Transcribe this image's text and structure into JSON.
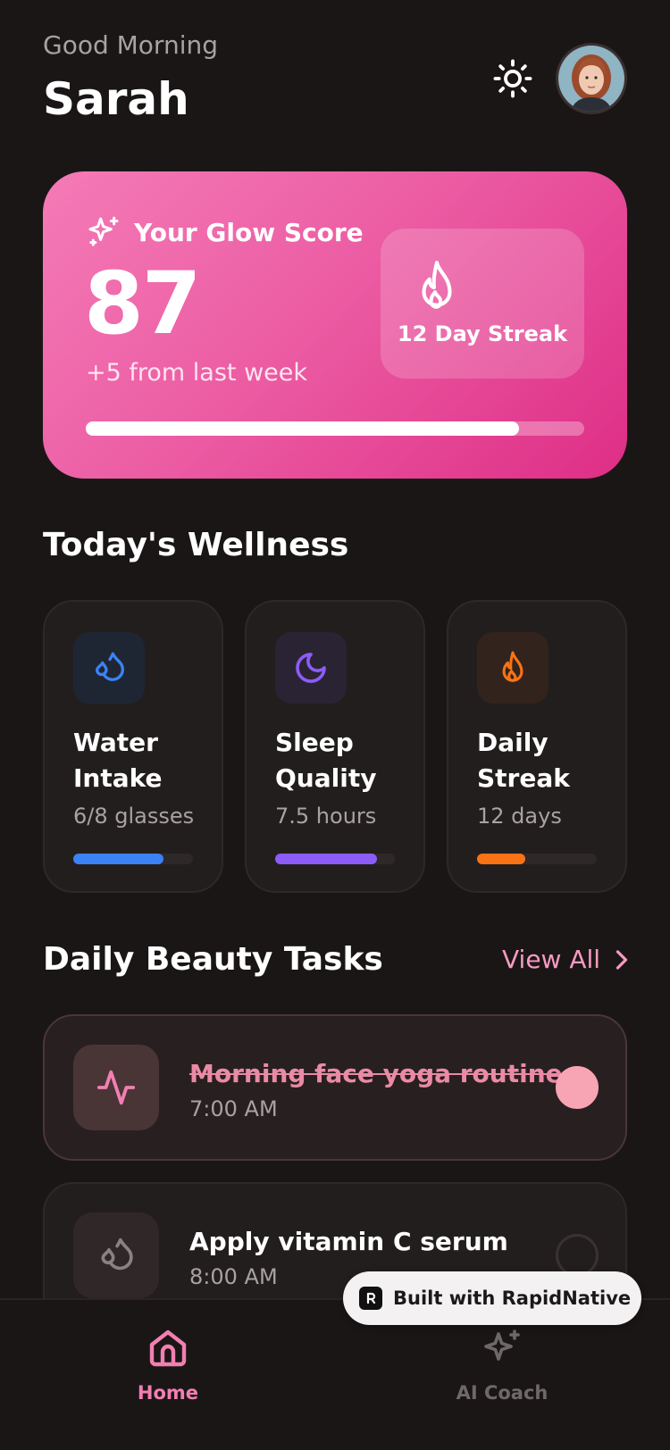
{
  "header": {
    "greeting": "Good Morning",
    "name": "Sarah"
  },
  "glow_card": {
    "title": "Your Glow Score",
    "score": "87",
    "change": "+5 from last week",
    "streak_label": "12 Day Streak",
    "progress": 0.87
  },
  "wellness": {
    "title": "Today's Wellness",
    "cards": [
      {
        "label": "Water Intake",
        "value": "6/8 glasses",
        "progress": 0.75,
        "color": "#3b82f6",
        "icon_bg": "#1f2633",
        "icon": "water-drops-icon"
      },
      {
        "label": "Sleep Quality",
        "value": "7.5 hours",
        "progress": 0.85,
        "color": "#8b5cf6",
        "icon_bg": "#2a2333",
        "icon": "moon-icon"
      },
      {
        "label": "Daily Streak",
        "value": "12 days",
        "progress": 0.4,
        "color": "#f97316",
        "icon_bg": "#33231d",
        "icon": "flame-icon"
      }
    ]
  },
  "tasks": {
    "title": "Daily Beauty Tasks",
    "view_all": "View All",
    "items": [
      {
        "name": "Morning face yoga routine",
        "time": "7:00 AM",
        "done": true,
        "icon": "activity-icon"
      },
      {
        "name": "Apply vitamin C serum",
        "time": "8:00 AM",
        "done": false,
        "icon": "droplets-icon"
      }
    ]
  },
  "nav": {
    "home": "Home",
    "coach": "AI Coach"
  },
  "badge": {
    "text": "Built with RapidNative"
  },
  "colors": {
    "background": "#1a1616",
    "accent_pink": "#f27fb2",
    "card": "#231e1e"
  }
}
